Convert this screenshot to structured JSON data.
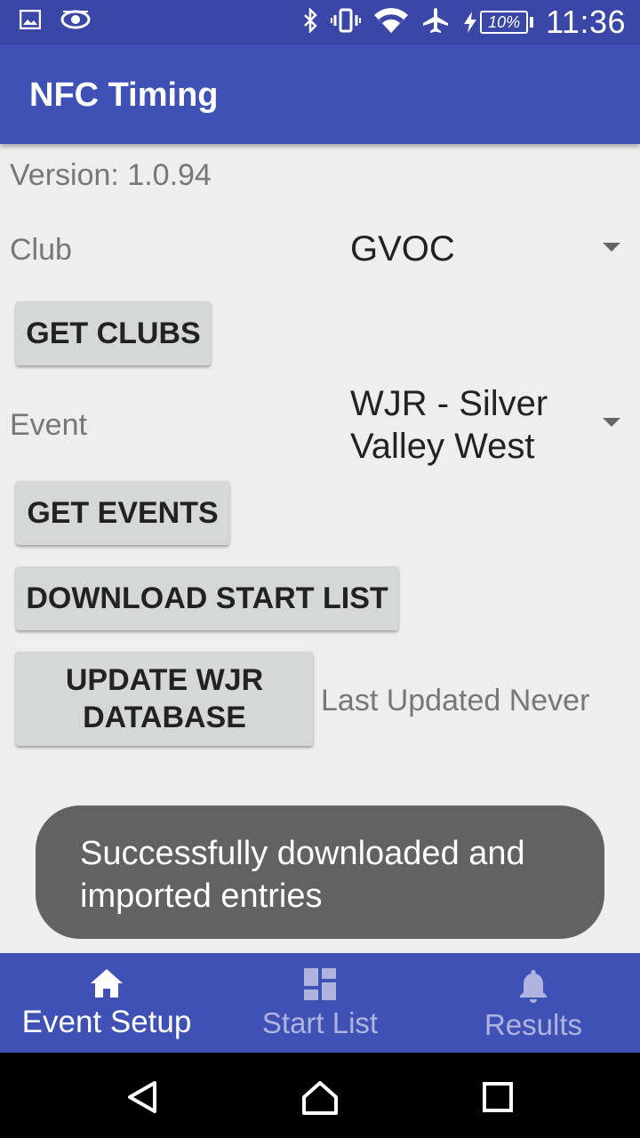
{
  "status_bar": {
    "time": "11:36",
    "battery": "10%",
    "icons": [
      "image-icon",
      "eye-icon",
      "bluetooth-icon",
      "vibrate-icon",
      "wifi-icon",
      "airplane-icon",
      "charging-icon",
      "battery-icon"
    ]
  },
  "app_bar": {
    "title": "NFC Timing"
  },
  "main": {
    "version": "Version: 1.0.94",
    "club_label": "Club",
    "club_value": "GVOC",
    "get_clubs_label": "GET CLUBS",
    "event_label": "Event",
    "event_value": "WJR - Silver Valley West",
    "get_events_label": "GET EVENTS",
    "download_start_list_label": "DOWNLOAD START LIST",
    "update_db_label": "UPDATE WJR DATABASE",
    "last_updated": "Last Updated Never"
  },
  "toast": {
    "message": "Successfully downloaded and imported entries"
  },
  "bottom_nav": {
    "items": [
      {
        "label": "Event Setup",
        "icon": "home-icon",
        "active": true
      },
      {
        "label": "Start List",
        "icon": "dashboard-icon",
        "active": false
      },
      {
        "label": "Results",
        "icon": "bell-icon",
        "active": false
      }
    ]
  },
  "system_nav": {
    "icons": [
      "back-icon",
      "home-icon",
      "recents-icon"
    ]
  },
  "colors": {
    "primary": "#3f51b5",
    "status_bar": "#3b47a6",
    "toast": "#626262",
    "background": "#eeeeee"
  }
}
